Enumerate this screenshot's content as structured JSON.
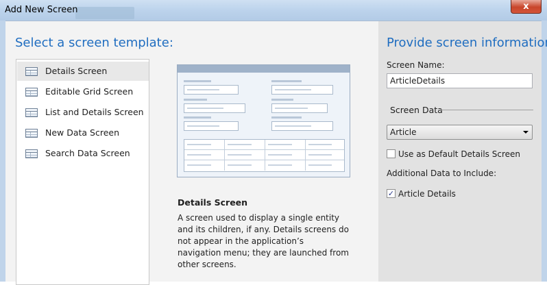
{
  "window": {
    "title": "Add New Screen",
    "close_glyph": "x"
  },
  "left": {
    "heading": "Select a screen template:",
    "templates": [
      {
        "label": "Details Screen",
        "icon": "details-screen-icon",
        "selected": true
      },
      {
        "label": "Editable Grid Screen",
        "icon": "editable-grid-screen-icon"
      },
      {
        "label": "List and Details Screen",
        "icon": "list-details-screen-icon"
      },
      {
        "label": "New Data Screen",
        "icon": "new-data-screen-icon"
      },
      {
        "label": "Search Data Screen",
        "icon": "search-data-screen-icon"
      }
    ]
  },
  "description": {
    "title": "Details Screen",
    "text": "A screen used to display a single entity and its children, if any.  Details screens do not appear in the application’s navigation menu; they are launched from other screens."
  },
  "right": {
    "heading": "Provide screen information:",
    "screen_name_label": "Screen Name:",
    "screen_name_value": "ArticleDetails",
    "screen_data_label": "Screen Data",
    "screen_data_value": "Article",
    "default_details_label": "Use as Default Details Screen",
    "default_details_checked": false,
    "additional_label": "Additional Data to Include:",
    "article_details_label": "Article Details",
    "article_details_checked": true,
    "check_glyph": "✓"
  },
  "colors": {
    "heading_blue": "#1f6dc0",
    "selection_gray": "#e8e8e8",
    "close_red": "#c8452b"
  }
}
